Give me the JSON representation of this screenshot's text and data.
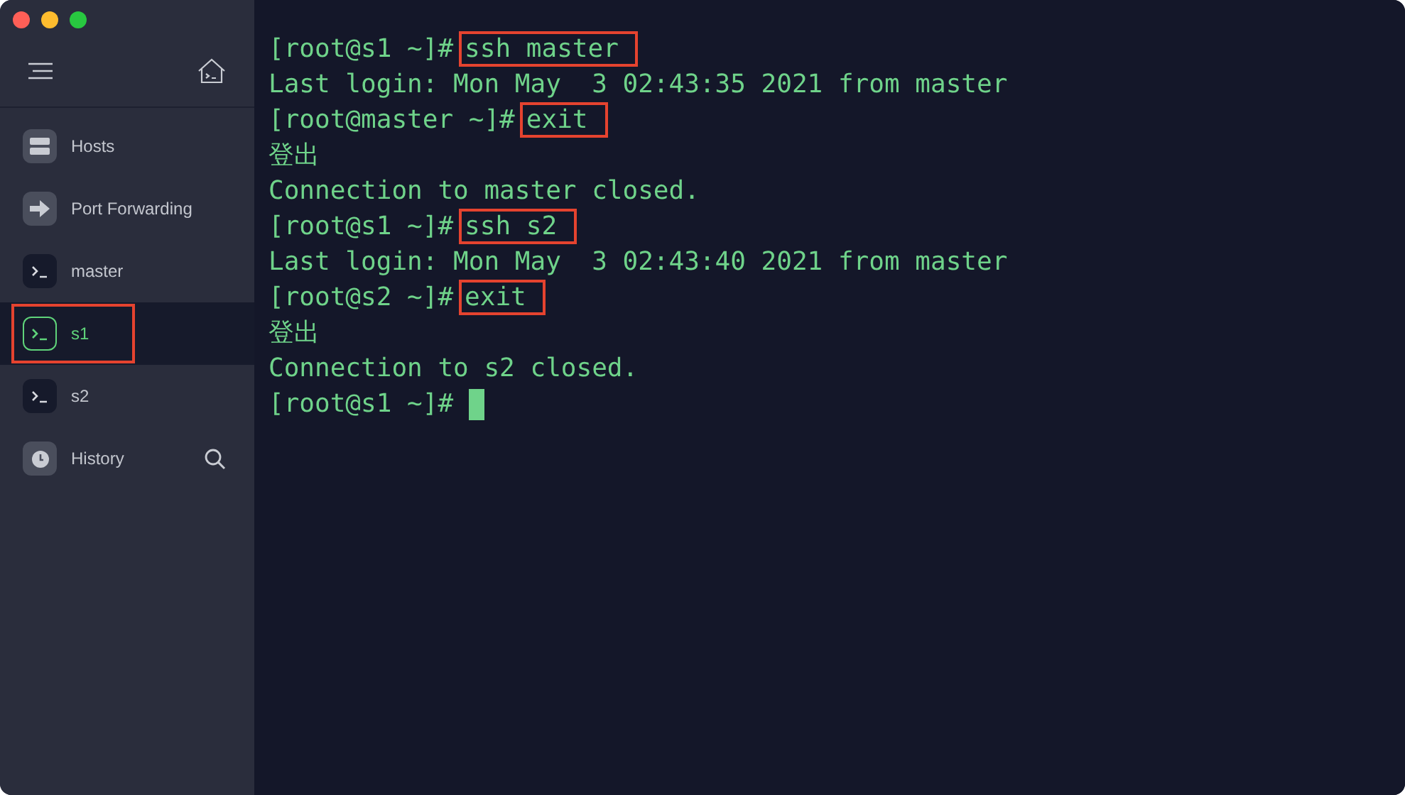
{
  "sidebar": {
    "items": [
      {
        "label": "Hosts",
        "kind": "hosts",
        "selected": false,
        "highlighted": false
      },
      {
        "label": "Port Forwarding",
        "kind": "forwarding",
        "selected": false,
        "highlighted": false
      },
      {
        "label": "master",
        "kind": "terminal",
        "selected": false,
        "highlighted": false
      },
      {
        "label": "s1",
        "kind": "terminal",
        "selected": true,
        "highlighted": true
      },
      {
        "label": "s2",
        "kind": "terminal",
        "selected": false,
        "highlighted": false
      },
      {
        "label": "History",
        "kind": "history",
        "selected": false,
        "highlighted": false
      }
    ]
  },
  "terminal": {
    "lines": [
      {
        "kind": "command",
        "prompt": "[root@s1 ~]#",
        "command": "ssh master",
        "highlighted": true
      },
      {
        "kind": "output",
        "text": "Last login: Mon May  3 02:43:35 2021 from master"
      },
      {
        "kind": "command",
        "prompt": "[root@master ~]#",
        "command": "exit",
        "highlighted": true
      },
      {
        "kind": "output",
        "text": "登出"
      },
      {
        "kind": "output",
        "text": "Connection to master closed."
      },
      {
        "kind": "command",
        "prompt": "[root@s1 ~]#",
        "command": "ssh s2",
        "highlighted": true
      },
      {
        "kind": "output",
        "text": "Last login: Mon May  3 02:43:40 2021 from master"
      },
      {
        "kind": "command",
        "prompt": "[root@s2 ~]#",
        "command": "exit",
        "highlighted": true
      },
      {
        "kind": "output",
        "text": "登出"
      },
      {
        "kind": "output",
        "text": "Connection to s2 closed."
      },
      {
        "kind": "command",
        "prompt": "[root@s1 ~]#",
        "cursor": true
      }
    ]
  }
}
